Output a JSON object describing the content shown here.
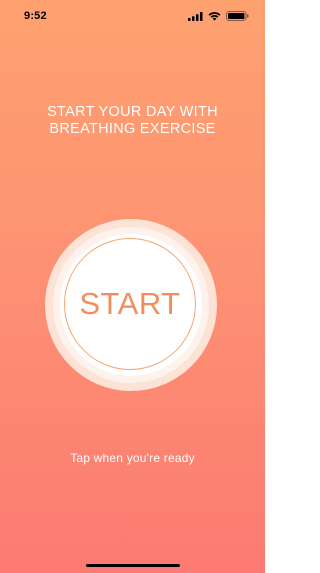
{
  "status_bar": {
    "time": "9:52",
    "icons": [
      "signal-icon",
      "wifi-icon",
      "battery-icon"
    ]
  },
  "heading": {
    "line1": "START YOUR DAY WITH",
    "line2": "BREATHING EXERCISE"
  },
  "start_button": {
    "label": "START"
  },
  "hint": "Tap when you're ready",
  "colors": {
    "background_top": "#fea16f",
    "background_bottom": "#fc7a72",
    "accent": "#f08e5e",
    "ring_outer": "#fde2d6",
    "ring_middle": "#fef2ec"
  }
}
